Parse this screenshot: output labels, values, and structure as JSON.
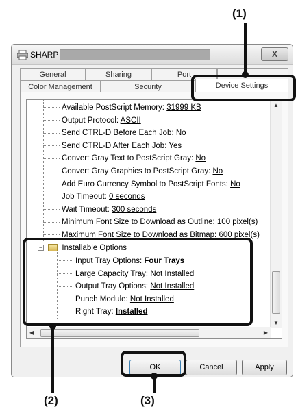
{
  "callouts": [
    "(1)",
    "(2)",
    "(3)"
  ],
  "dialog": {
    "title": "SHARP",
    "close_label": "X",
    "tabs_row1": [
      "General",
      "Sharing",
      "Port",
      ""
    ],
    "tabs_row2": [
      "Color Management",
      "Security",
      "Device Settings"
    ],
    "active_tab": "Device Settings"
  },
  "tree": [
    {
      "label": "Available PostScript Memory: ",
      "value": "31999 KB"
    },
    {
      "label": "Output Protocol: ",
      "value": "ASCII"
    },
    {
      "label": "Send CTRL-D Before Each Job: ",
      "value": "No"
    },
    {
      "label": "Send CTRL-D After Each Job: ",
      "value": "Yes"
    },
    {
      "label": "Convert Gray Text to PostScript Gray: ",
      "value": "No"
    },
    {
      "label": "Convert Gray Graphics to PostScript Gray: ",
      "value": "No"
    },
    {
      "label": "Add Euro Currency Symbol to PostScript Fonts: ",
      "value": "No"
    },
    {
      "label": "Job Timeout: ",
      "value": "0 seconds"
    },
    {
      "label": "Wait Timeout: ",
      "value": "300 seconds"
    },
    {
      "label": "Minimum Font Size to Download as Outline: ",
      "value": "100 pixel(s)"
    },
    {
      "label": "Maximum Font Size to Download as Bitmap: ",
      "value": "600 pixel(s)"
    }
  ],
  "installable": {
    "header": "Installable Options",
    "items": [
      {
        "label": "Input Tray Options: ",
        "value": "Four Trays"
      },
      {
        "label": "Large Capacity Tray: ",
        "value": "Not Installed"
      },
      {
        "label": "Output Tray Options: ",
        "value": "Not Installed"
      },
      {
        "label": "Punch Module: ",
        "value": "Not Installed"
      },
      {
        "label": "Right Tray: ",
        "value": "Installed"
      }
    ]
  },
  "buttons": {
    "ok": "OK",
    "cancel": "Cancel",
    "apply": "Apply"
  }
}
